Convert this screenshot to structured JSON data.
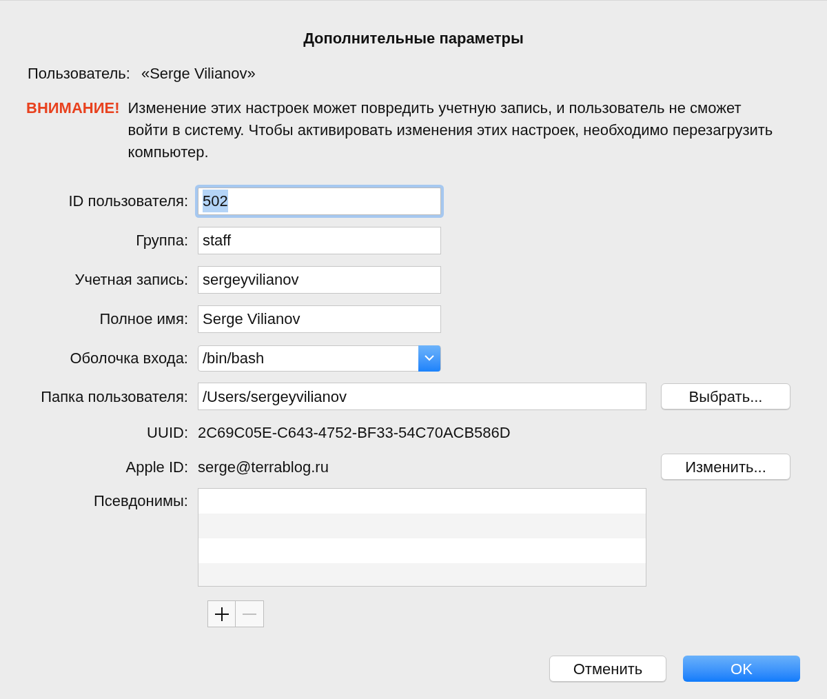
{
  "dialog": {
    "title": "Дополнительные параметры"
  },
  "user": {
    "label": "Пользователь:",
    "value": "«Serge Vilianov»"
  },
  "warning": {
    "label": "ВНИМАНИЕ!",
    "text": "Изменение этих настроек может повредить учетную запись, и пользователь не сможет войти в систему. Чтобы активировать изменения этих настроек, необходимо перезагрузить компьютер."
  },
  "fields": [
    {
      "kind": "text",
      "label": "ID пользователя:",
      "value": "502",
      "focused": true
    },
    {
      "kind": "text",
      "label": "Группа:",
      "value": "staff",
      "focused": false
    },
    {
      "kind": "text",
      "label": "Учетная запись:",
      "value": "sergeyvilianov",
      "focused": false
    },
    {
      "kind": "text",
      "label": "Полное имя:",
      "value": "Serge Vilianov",
      "focused": false
    },
    {
      "kind": "popup",
      "label": "Оболочка входа:",
      "value": "/bin/bash"
    },
    {
      "kind": "wide",
      "label": "Папка пользователя:",
      "value": "/Users/sergeyvilianov",
      "button": "Выбрать..."
    },
    {
      "kind": "info",
      "label": "UUID:",
      "value": "2C69C05E-C643-4752-BF33-54C70ACB586D"
    },
    {
      "kind": "info",
      "label": "Apple ID:",
      "value": "serge@terrablog.ru",
      "button": "Изменить..."
    },
    {
      "kind": "list",
      "label": "Псевдонимы:"
    }
  ],
  "list_buttons": [
    {
      "kind": "add",
      "disabled": false
    },
    {
      "kind": "remove",
      "disabled": true
    }
  ],
  "buttons": [
    {
      "label": "Отменить",
      "default": false
    },
    {
      "label": "OK",
      "default": true
    }
  ]
}
